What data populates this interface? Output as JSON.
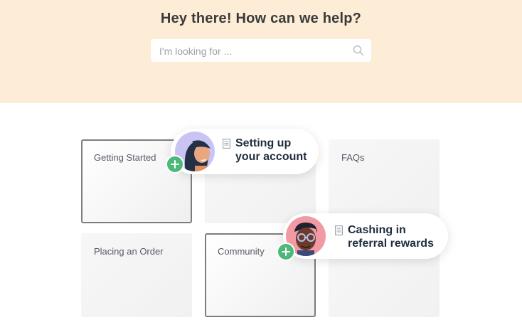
{
  "hero": {
    "title": "Hey there! How can we help?",
    "search_placeholder": "I'm looking for ..."
  },
  "categories": [
    {
      "label": "Getting Started"
    },
    {
      "label": ""
    },
    {
      "label": "FAQs"
    },
    {
      "label": "Placing an Order"
    },
    {
      "label": "Community"
    },
    {
      "label": ""
    }
  ],
  "popups": [
    {
      "line1": "Setting up",
      "line2": "your account"
    },
    {
      "line1": "Cashing in",
      "line2": "referral rewards"
    }
  ],
  "colors": {
    "hero_bg": "#fdecd6",
    "plus_green": "#4cb87a",
    "avatar1_bg": "#c9c4f4",
    "avatar2_bg": "#f29aa3"
  },
  "icons": [
    "search-icon",
    "document-icon",
    "plus-icon",
    "avatar"
  ]
}
